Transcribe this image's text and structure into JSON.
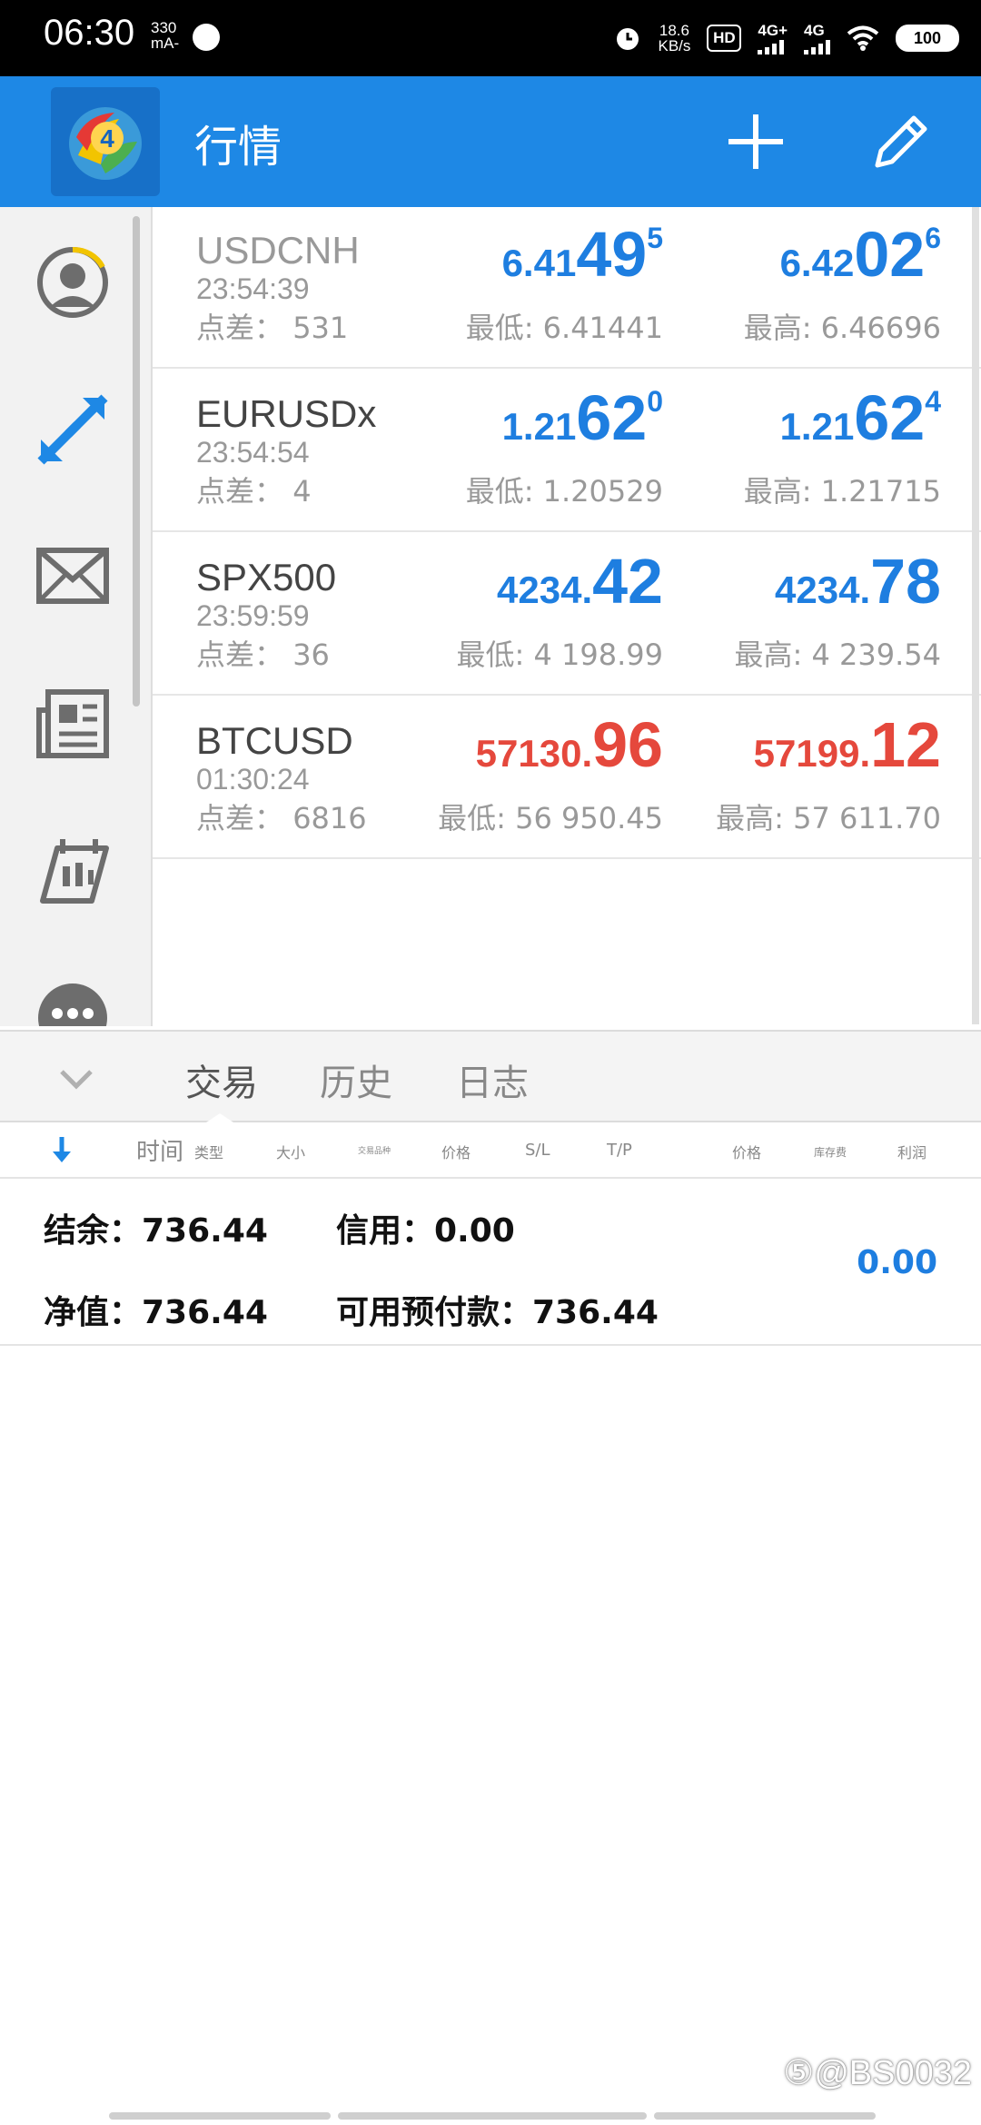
{
  "status_bar": {
    "time": "06:30",
    "current_top": "330",
    "current_bottom": "mA-",
    "speed_top": "18.6",
    "speed_bottom": "KB/s",
    "hd_label": "HD",
    "net1_label": "4G+",
    "net2_label": "4G",
    "battery": "100",
    "icons": [
      "jovi-icon",
      "alarm-icon",
      "hd-icon",
      "signal-4g-plus-icon",
      "signal-4g-icon",
      "wifi-icon",
      "battery-icon"
    ]
  },
  "app_bar": {
    "title": "行情",
    "icons": [
      "metatrader-logo-icon",
      "plus-icon",
      "pencil-icon"
    ]
  },
  "nav": {
    "icons": [
      "account-icon",
      "trade-arrows-icon",
      "mail-icon",
      "news-icon",
      "calendar-icon",
      "more-icon"
    ]
  },
  "quotes": [
    {
      "symbol": "USDCNH",
      "time": "23:54:39",
      "spread_label": "点差：",
      "spread": "531",
      "bid_small": "6.41",
      "bid_big": "49",
      "bid_sup": "5",
      "ask_small": "6.42",
      "ask_big": "02",
      "ask_sup": "6",
      "low": "最低: 6.41441",
      "high": "最高: 6.46696",
      "color": "#1e7ee0"
    },
    {
      "symbol": "EURUSDx",
      "time": "23:54:54",
      "spread_label": "点差：",
      "spread": "4",
      "bid_small": "1.21",
      "bid_big": "62",
      "bid_sup": "0",
      "ask_small": "1.21",
      "ask_big": "62",
      "ask_sup": "4",
      "low": "最低: 1.20529",
      "high": "最高: 1.21715",
      "color": "#1e7ee0"
    },
    {
      "symbol": "SPX500",
      "time": "23:59:59",
      "spread_label": "点差：",
      "spread": "36",
      "bid_small": "4234.",
      "bid_big": "42",
      "ask_small": "4234.",
      "ask_big": "78",
      "low": "最低: 4 198.99",
      "high": "最高: 4 239.54",
      "color": "#1e7ee0"
    },
    {
      "symbol": "BTCUSD",
      "time": "01:30:24",
      "spread_label": "点差：",
      "spread": "6816",
      "bid_small": "57130.",
      "bid_big": "96",
      "ask_small": "57199.",
      "ask_big": "12",
      "low": "最低: 56 950.45",
      "high": "最高: 57 611.70",
      "color": "#e5483c"
    }
  ],
  "tabs": [
    {
      "label": "交易",
      "active": true
    },
    {
      "label": "历史",
      "active": false
    },
    {
      "label": "日志",
      "active": false
    }
  ],
  "columns": {
    "time": "时间",
    "type": "类型",
    "size": "大小",
    "symbol": "交易品种",
    "price": "价格",
    "sl": "S/L",
    "tp": "T/P",
    "price2": "价格",
    "swap": "库存费",
    "profit": "利润"
  },
  "summary": {
    "balance": "结余：736.44",
    "credit": "信用：0.00",
    "equity": "净值：736.44",
    "free_margin": "可用预付款：736.44",
    "profit": "0.00"
  },
  "watermark": "⑤@BS0032"
}
